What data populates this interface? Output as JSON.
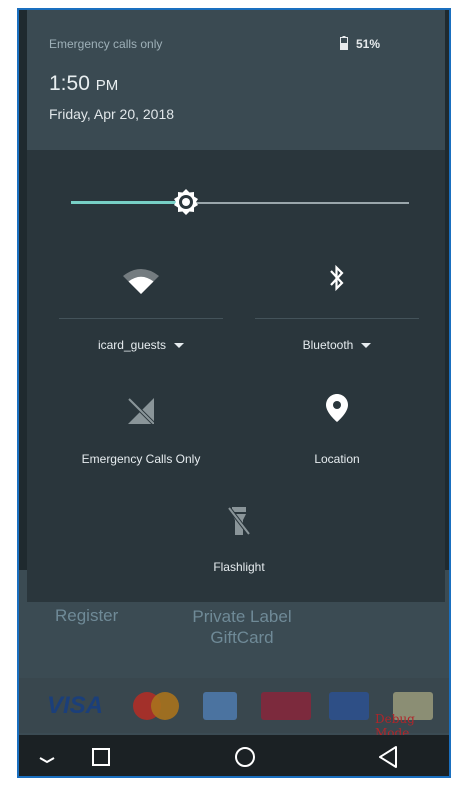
{
  "status_bar": {
    "carrier_text": "Emergency calls only",
    "battery_level": "51%"
  },
  "clock": {
    "time": "1:50",
    "ampm": "PM",
    "date": "Friday, Apr 20, 2018"
  },
  "brightness": {
    "level": 0.34
  },
  "tiles": {
    "wifi": {
      "label": "icard_guests",
      "icon": "wifi-icon"
    },
    "bluetooth": {
      "label": "Bluetooth",
      "icon": "bluetooth-icon"
    },
    "cellular": {
      "label": "Emergency Calls Only",
      "icon": "no-signal-icon"
    },
    "location": {
      "label": "Location",
      "icon": "location-pin-icon"
    },
    "flashlight": {
      "label": "Flashlight",
      "icon": "flashlight-off-icon"
    }
  },
  "background_app": {
    "register_label": "Register",
    "gift_label": "Private Label GiftCard",
    "cards": [
      "VISA"
    ],
    "debug_label": "Debug Mode"
  },
  "nav_bar": {
    "icons": [
      "collapse-icon",
      "recents-icon",
      "home-icon",
      "back-icon"
    ]
  },
  "colors": {
    "accent": "#78d0c6",
    "panel": "#2a363c",
    "header": "#3a4a52",
    "debug": "#b0262a"
  }
}
